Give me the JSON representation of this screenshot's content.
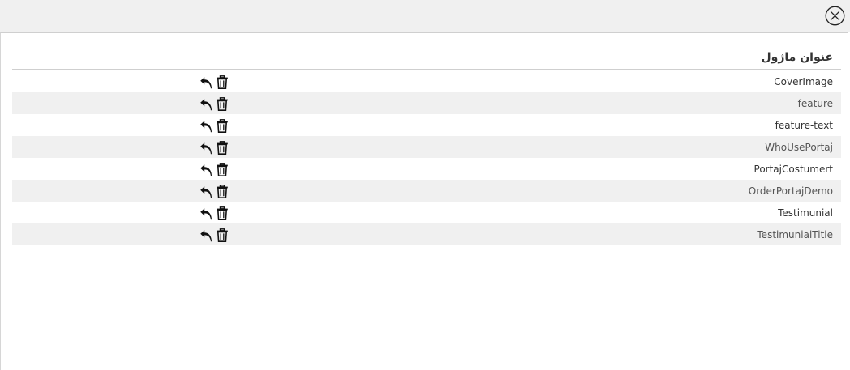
{
  "header": {
    "close_icon": "close-circle-icon"
  },
  "table": {
    "column_title": "عنوان ماژول",
    "rows": [
      {
        "label": "CoverImage"
      },
      {
        "label": "feature"
      },
      {
        "label": "feature-text"
      },
      {
        "label": "WhoUsePortaj"
      },
      {
        "label": "PortajCostumert"
      },
      {
        "label": "OrderPortajDemo"
      },
      {
        "label": "Testimunial"
      },
      {
        "label": "TestimunialTitle"
      }
    ],
    "row_icons": [
      "reply-icon",
      "trash-icon"
    ]
  },
  "colors": {
    "topbar": "#f0f0f0",
    "row_alt": "#f0f0f0",
    "text": "#333333",
    "icon": "#111111"
  }
}
